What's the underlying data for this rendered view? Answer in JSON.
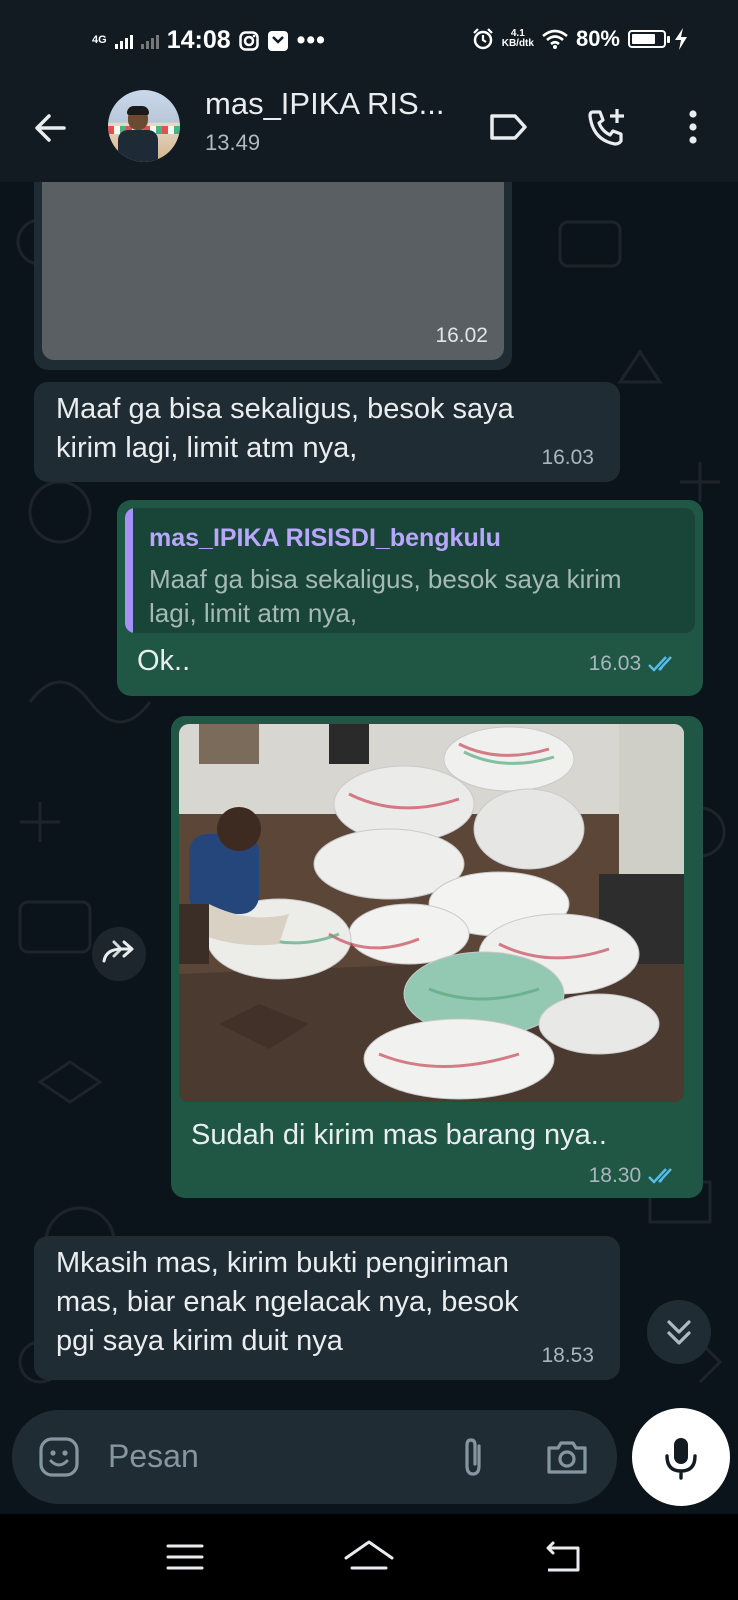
{
  "status_bar": {
    "network": "4G",
    "time": "14:08",
    "speed_value": "4.1",
    "speed_unit": "KB/dtk",
    "battery": "80%",
    "battery_level": 0.8
  },
  "header": {
    "contact_name": "mas_IPIKA RIS...",
    "subtitle": "13.49"
  },
  "messages": [
    {
      "id": "m1",
      "direction": "incoming",
      "type": "image-blurred",
      "time": "16.02"
    },
    {
      "id": "m2",
      "direction": "incoming",
      "type": "text",
      "text": "Maaf ga bisa sekaligus, besok saya\nkirim lagi,  limit atm nya,",
      "time": "16.03"
    },
    {
      "id": "m3",
      "direction": "outgoing",
      "type": "reply",
      "quote_author": "mas_IPIKA RISISDI_bengkulu",
      "quote_text": "Maaf ga bisa sekaligus, besok saya kirim\nlagi,  limit atm nya,",
      "text": "Ok..",
      "time": "16.03",
      "status": "read"
    },
    {
      "id": "m4",
      "direction": "outgoing",
      "type": "image",
      "caption": "Sudah di kirim mas barang nya..",
      "time": "18.30",
      "status": "read"
    },
    {
      "id": "m5",
      "direction": "incoming",
      "type": "text",
      "text": "Mkasih mas, kirim bukti pengiriman\nmas, biar enak ngelacak nya, besok\npgi saya kirim duit nya",
      "time": "18.53"
    }
  ],
  "input": {
    "placeholder": "Pesan"
  },
  "colors": {
    "background": "#0b141a",
    "incoming_bubble": "#202c33",
    "outgoing_bubble": "#1f5644",
    "read_ticks": "#53bdeb",
    "quote_accent": "#a791f7"
  },
  "icons": [
    "back-arrow-icon",
    "label-icon",
    "add-call-icon",
    "more-vert-icon",
    "forward-icon",
    "double-chevron-down-icon",
    "emoji-icon",
    "attach-icon",
    "camera-icon",
    "mic-icon",
    "menu-icon",
    "home-icon",
    "back-nav-icon"
  ]
}
